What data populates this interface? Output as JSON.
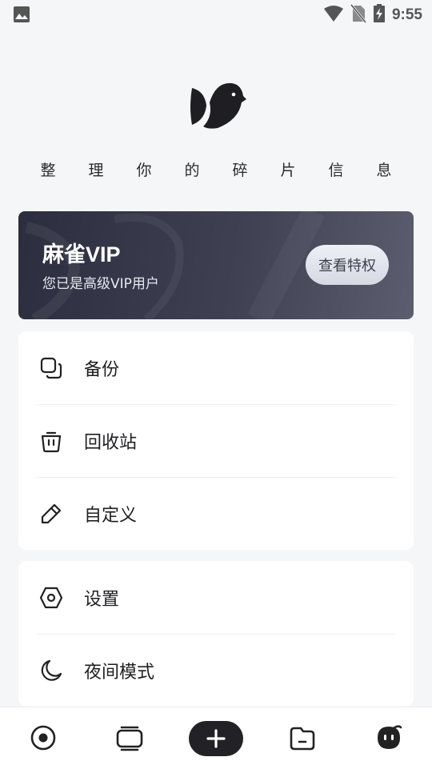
{
  "status_bar": {
    "time": "9:55",
    "icons": [
      "image-icon",
      "wifi-icon",
      "no-sim-icon",
      "battery-charging-icon"
    ]
  },
  "header": {
    "logo_icon": "sparrow-logo-icon",
    "slogan": [
      "整",
      "理",
      "你",
      "的",
      "碎",
      "片",
      "信",
      "息"
    ]
  },
  "vip": {
    "title": "麻雀VIP",
    "subtitle": "您已是高级VIP用户",
    "button_label": "查看特权"
  },
  "menu_primary": [
    {
      "label": "备份",
      "icon": "copy-icon"
    },
    {
      "label": "回收站",
      "icon": "trash-icon"
    },
    {
      "label": "自定义",
      "icon": "pencil-icon"
    }
  ],
  "menu_secondary": [
    {
      "label": "设置",
      "icon": "settings-hexagon-icon"
    },
    {
      "label": "夜间模式",
      "icon": "moon-icon"
    }
  ],
  "bottom_nav": {
    "items": [
      "target-icon",
      "cards-icon",
      "add-icon",
      "folder-icon",
      "profile-face-icon"
    ]
  },
  "colors": {
    "background": "#f5f6f8",
    "vip_gradient_start": "#2c2d3e",
    "vip_gradient_end": "#5c5e70",
    "accent_dark": "#222226"
  }
}
